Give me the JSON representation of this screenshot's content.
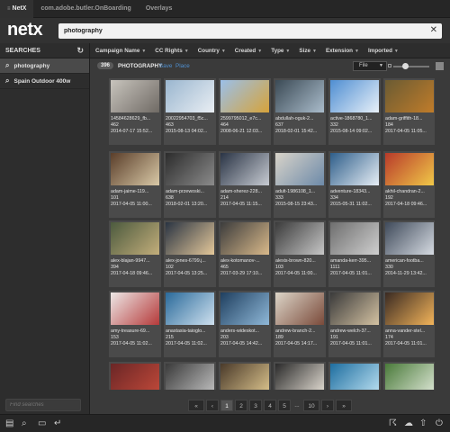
{
  "tabs": [
    {
      "label": "NetX",
      "menu_icon": "≡"
    },
    {
      "label": "com.adobe.butler.OnBoarding"
    },
    {
      "label": "Overlays"
    }
  ],
  "header": {
    "logo": "netx",
    "search_value": "photography",
    "clear_icon": "✕"
  },
  "sidebar": {
    "title": "SEARCHES",
    "refresh_icon": "↻",
    "items": [
      {
        "label": "photography",
        "active": true
      },
      {
        "label": "Spain Outdoor 400w",
        "active": false
      }
    ],
    "find_placeholder": "Find searches"
  },
  "filters": [
    "Campaign Name",
    "CC Rights",
    "Country",
    "Created",
    "Type",
    "Size",
    "Extension",
    "Imported"
  ],
  "subbar": {
    "count": "396",
    "crumb": "PHOTOGRAPHY",
    "save": "Save",
    "place": "Place",
    "sort": "File"
  },
  "assets": [
    {
      "name": "14584628629_fb...",
      "id": "462",
      "date": "2014-07-17 15:52...",
      "colors": [
        "#c8c4bd",
        "#6f6a64"
      ]
    },
    {
      "name": "20022954703_f5c...",
      "id": "463",
      "date": "2015-08-13 04:02...",
      "colors": [
        "#9ab6cf",
        "#e9eef3"
      ]
    },
    {
      "name": "2599795012_e7c...",
      "id": "464",
      "date": "2008-06-21 12:03...",
      "colors": [
        "#9bc0ea",
        "#d6a33a"
      ]
    },
    {
      "name": "abdullah-oguk-2...",
      "id": "637",
      "date": "2018-02-01 15:42...",
      "colors": [
        "#3b4a55",
        "#aabccb"
      ]
    },
    {
      "name": "active-1868780_1...",
      "id": "332",
      "date": "2015-08-14 09:02...",
      "colors": [
        "#4f8ed2",
        "#e8f0f8"
      ]
    },
    {
      "name": "adam-griffith-18...",
      "id": "184",
      "date": "2017-04-05 11:05...",
      "colors": [
        "#6a5b33",
        "#c07c2a"
      ]
    },
    {
      "name": "adam-jaime-119...",
      "id": "101",
      "date": "2017-04-05 11:00...",
      "colors": [
        "#5a3e2a",
        "#d9c9a7"
      ]
    },
    {
      "name": "adam-przewoski...",
      "id": "638",
      "date": "2018-02-01 13:20...",
      "colors": [
        "#2c2c2c",
        "#8b8b8b"
      ]
    },
    {
      "name": "adam-sherez-228...",
      "id": "214",
      "date": "2017-04-05 11:15...",
      "colors": [
        "#2a3445",
        "#c7cbd2"
      ]
    },
    {
      "name": "adult-1986108_1...",
      "id": "333",
      "date": "2015-08-15 23:43...",
      "colors": [
        "#d8d3c9",
        "#6d8aa9"
      ]
    },
    {
      "name": "adventure-18343...",
      "id": "334",
      "date": "2015-05-31 11:02...",
      "colors": [
        "#2e5e8a",
        "#e7eef5"
      ]
    },
    {
      "name": "akhil-chandran-2...",
      "id": "192",
      "date": "2017-04-18 09:46...",
      "colors": [
        "#b83a2a",
        "#f0c848"
      ]
    },
    {
      "name": "alex-blajan-9947...",
      "id": "394",
      "date": "2017-04-18 09:46...",
      "colors": [
        "#4c5a3e",
        "#c3ae7b"
      ]
    },
    {
      "name": "alex-jones-6799.j...",
      "id": "102",
      "date": "2017-04-05 13:25...",
      "colors": [
        "#2a3442",
        "#e4c89a"
      ]
    },
    {
      "name": "alex-kotomanov-...",
      "id": "465",
      "date": "2017-03-29 17:10...",
      "colors": [
        "#3c3c3c",
        "#d9b98a"
      ]
    },
    {
      "name": "alexis-brown-820...",
      "id": "103",
      "date": "2017-04-05 11:00...",
      "colors": [
        "#3b3b3b",
        "#c6c6c6"
      ]
    },
    {
      "name": "amanda-kerr-395...",
      "id": "1111",
      "date": "2017-04-05 11:01...",
      "colors": [
        "#6e6e6e",
        "#cfcfcf"
      ]
    },
    {
      "name": "american-footba...",
      "id": "330",
      "date": "2014-11-29 13:42...",
      "colors": [
        "#3f4a5a",
        "#d6dbe2"
      ]
    },
    {
      "name": "amy-treasure-69...",
      "id": "153",
      "date": "2017-04-05 11:02...",
      "colors": [
        "#ede7e6",
        "#b53a3a"
      ]
    },
    {
      "name": "anastasia-taioglo...",
      "id": "215",
      "date": "2017-04-05 11:02...",
      "colors": [
        "#2a6a9a",
        "#cfe1ef"
      ]
    },
    {
      "name": "anders-wideskot...",
      "id": "203",
      "date": "2017-04-05 14:42...",
      "colors": [
        "#1f3f5f",
        "#8fb8d8"
      ]
    },
    {
      "name": "andrew-branch-2...",
      "id": "189",
      "date": "2017-04-05 14:17...",
      "colors": [
        "#dcd5c8",
        "#7a4a3a"
      ]
    },
    {
      "name": "andrew-welch-37...",
      "id": "191",
      "date": "2017-04-05 11:01...",
      "colors": [
        "#3a3a3a",
        "#d4c2a2"
      ]
    },
    {
      "name": "anna-vander-stel...",
      "id": "174",
      "date": "2017-04-05 11:01...",
      "colors": [
        "#3a2a22",
        "#f2b45a"
      ]
    },
    {
      "name": "",
      "id": "",
      "date": "",
      "colors": [
        "#6a2626",
        "#c34a3a"
      ]
    },
    {
      "name": "",
      "id": "",
      "date": "",
      "colors": [
        "#3a3a3a",
        "#c3c3c3"
      ]
    },
    {
      "name": "",
      "id": "",
      "date": "",
      "colors": [
        "#4a3a2a",
        "#e0c890"
      ]
    },
    {
      "name": "",
      "id": "",
      "date": "",
      "colors": [
        "#2a2a2a",
        "#e8e2d8"
      ]
    },
    {
      "name": "",
      "id": "",
      "date": "",
      "colors": [
        "#1e6ea0",
        "#bfe3f3"
      ]
    },
    {
      "name": "",
      "id": "",
      "date": "",
      "colors": [
        "#4a7a3a",
        "#dfe8d8"
      ]
    }
  ],
  "pager": {
    "first": "«",
    "prev": "‹",
    "pages": [
      "1",
      "2",
      "3",
      "4",
      "5"
    ],
    "current": "1",
    "ellipsis": "...",
    "last_page": "10",
    "next": "›",
    "last": "»"
  },
  "bottom_icons": {
    "folder": "▤",
    "search": "⌕",
    "inbox": "▭",
    "exit": "↵",
    "cart": "☈",
    "cloud": "☁",
    "upload": "⇧",
    "power": "⏻"
  }
}
